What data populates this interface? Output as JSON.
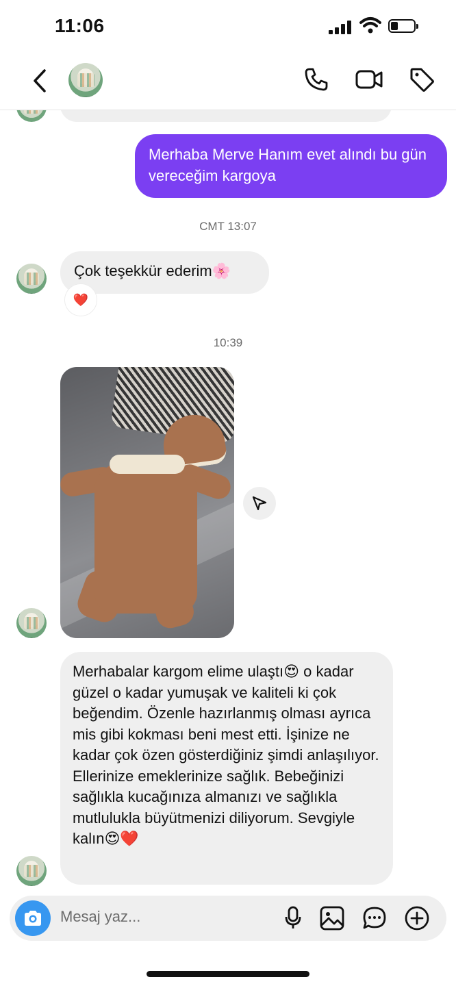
{
  "status_bar": {
    "time": "11:06"
  },
  "header": {
    "back_icon": "chevron-left-icon",
    "call_icon": "phone-icon",
    "video_icon": "video-icon",
    "tag_icon": "tag-icon"
  },
  "messages": {
    "out1": "Merhaba Merve Hanım evet alındı bu gün vereceğim kargoya",
    "ts1": "CMT 13:07",
    "in1": "Çok teşekkür ederim🌸",
    "in1_reaction": "❤️",
    "ts2": "10:39",
    "in2": "Merhabalar kargom elime ulaştı😍 o kadar güzel o kadar yumuşak ve kaliteli ki çok beğendim. Özenle hazırlanmış olması ayrıca mis gibi kokması beni mest etti. İşinize ne kadar çok özen gösterdiğiniz şimdi anlaşılıyor. Ellerinize emeklerinize sağlık. Bebeğinizi sağlıkla kucağınıza almanızı ve sağlıkla mutlulukla büyütmenizi diliyorum. Sevgiyle kalın😍❤️"
  },
  "composer": {
    "placeholder": "Mesaj yaz..."
  },
  "colors": {
    "accent": "#7b3ff2",
    "camera": "#3797f0",
    "bubble_in": "#efefef"
  }
}
